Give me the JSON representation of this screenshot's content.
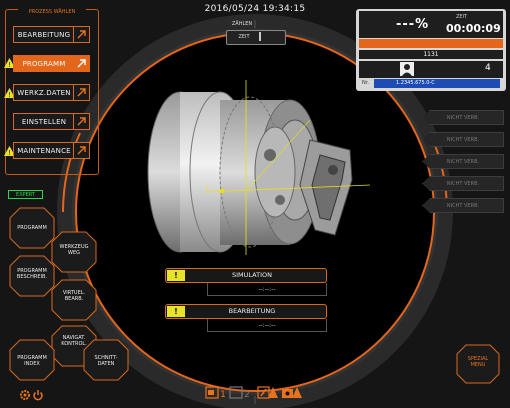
{
  "header": {
    "datetime": "2016/05/24 19:34:15",
    "mode_top": "ZÄHLEN",
    "mode_sub": "ZEIT"
  },
  "menu": {
    "title": "PROZESS WÄHLEN",
    "items": [
      {
        "label": "BEARBEITUNG",
        "active": false,
        "warning": false
      },
      {
        "label": "PROGRAMM",
        "active": true,
        "warning": true
      },
      {
        "label": "WERKZ.DATEN",
        "active": false,
        "warning": true
      },
      {
        "label": "EINSTELLEN",
        "active": false,
        "warning": false
      },
      {
        "label": "MAINTENANCE",
        "active": false,
        "warning": true
      }
    ]
  },
  "expert_label": "EXPERT",
  "hex_buttons": [
    {
      "label": "PROGRAMM"
    },
    {
      "label": "WERKZEUG WEG"
    },
    {
      "label": "PROGRAMM BESCHREIB."
    },
    {
      "label": "VIRTUEL. BEARB."
    },
    {
      "label": "NAVIGAT. KONTROL."
    },
    {
      "label": "PROGRAMM INDEX"
    },
    {
      "label": "SCHNITT- DATEN"
    }
  ],
  "status": {
    "percent": "---%",
    "zeit_label": "ZEIT",
    "time": "00:00:09",
    "progress_fraction": 1.0,
    "count": "1131",
    "user_count": "4",
    "program_id_label": "Nr.",
    "program_id": "1.2345.675.0-C"
  },
  "side_buttons": [
    "NICHT VERB.",
    "NICHT VERB.",
    "NICHT VERB.",
    "NICHT VERB.",
    "NICHT VERB."
  ],
  "simulation": {
    "title": "SIMULATION",
    "time": "--:--:--"
  },
  "bearbeitung": {
    "title": "BEARBEITUNG",
    "time": "--:--:--"
  },
  "spezial": "SPEZIAL MENU",
  "axis_label": "Y",
  "colors": {
    "accent": "#e4661a",
    "warning": "#e8e22a",
    "ok": "#2bd84a",
    "id_blue": "#1d4cb5"
  }
}
